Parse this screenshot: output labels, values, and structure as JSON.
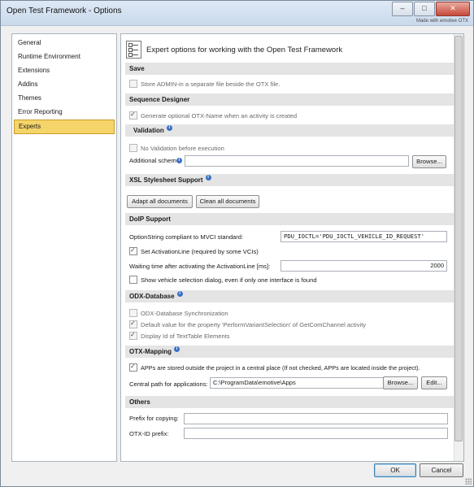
{
  "window": {
    "title": "Open Test Framework - Options",
    "made_with": "Made with emotive OTX",
    "buttons": {
      "minimize": "–",
      "maximize": "□",
      "close": "✕"
    }
  },
  "nav": {
    "items": [
      {
        "label": "General"
      },
      {
        "label": "Runtime Environment"
      },
      {
        "label": "Extensions"
      },
      {
        "label": "Addins"
      },
      {
        "label": "Themes"
      },
      {
        "label": "Error Reporting"
      },
      {
        "label": "Experts",
        "selected": true
      }
    ]
  },
  "header": {
    "title": "Expert options for working with the Open Test Framework"
  },
  "save": {
    "title": "Save",
    "store_admin": {
      "label": "Store ADMIN-in a separate file beside the OTX file.",
      "checked": false,
      "enabled": false
    }
  },
  "sequence_designer": {
    "title": "Sequence Designer",
    "generate_name": {
      "label": "Generate optional OTX-Name when an activity is created",
      "checked": true,
      "enabled": false
    }
  },
  "validation": {
    "title": "Validation",
    "no_validation": {
      "label": "No Validation before execution",
      "checked": false,
      "enabled": false
    },
    "additional_schema_label": "Additional schem",
    "additional_schema_value": "",
    "browse": "Browse..."
  },
  "xsl": {
    "title": "XSL Stylesheet Support",
    "adapt_all": "Adapt all documents",
    "clean_all": "Clean all documents"
  },
  "doip": {
    "title": "DoIP Support",
    "option_string_label": "OptionString compliant to MVCI standard:",
    "option_string_value": "PDU_IOCTL='PDU_IOCTL_VEHICLE_ID_REQUEST'",
    "set_activation": {
      "label": "Set ActivationLine (required by some VCIs)",
      "checked": true
    },
    "waiting_label": "Waiting time after activating the ActivationLine [ms]:",
    "waiting_value": "2000",
    "show_vehicle": {
      "label": "Show vehicle selection dialog, even if only one interface is found",
      "checked": false
    }
  },
  "odx": {
    "title": "ODX-Database",
    "sync": {
      "label": "ODX-Database Synchronization",
      "checked": false,
      "enabled": false
    },
    "default_value": {
      "label": "Default value for the property 'PerformVariantSelection' of GetComChannel activity",
      "checked": true,
      "enabled": false
    },
    "display_id": {
      "label": "Display Id of TextTable Elements",
      "checked": true,
      "enabled": false
    }
  },
  "otx_mapping": {
    "title": "OTX-Mapping",
    "apps_outside": {
      "label": "APPs are stored outside the project in a central place (If not checked, APPs are located inside the project).",
      "checked": true
    },
    "central_path_label": "Central path for applications:",
    "central_path_value": "C:\\ProgramData\\emotive\\Apps",
    "browse": "Browse...",
    "edit": "Edit..."
  },
  "others": {
    "title": "Others",
    "prefix_copy_label": "Prefix for copying:",
    "prefix_copy_value": "",
    "otx_id_label": "OTX-ID prefix:",
    "otx_id_value": ""
  },
  "footer": {
    "ok": "OK",
    "cancel": "Cancel"
  }
}
